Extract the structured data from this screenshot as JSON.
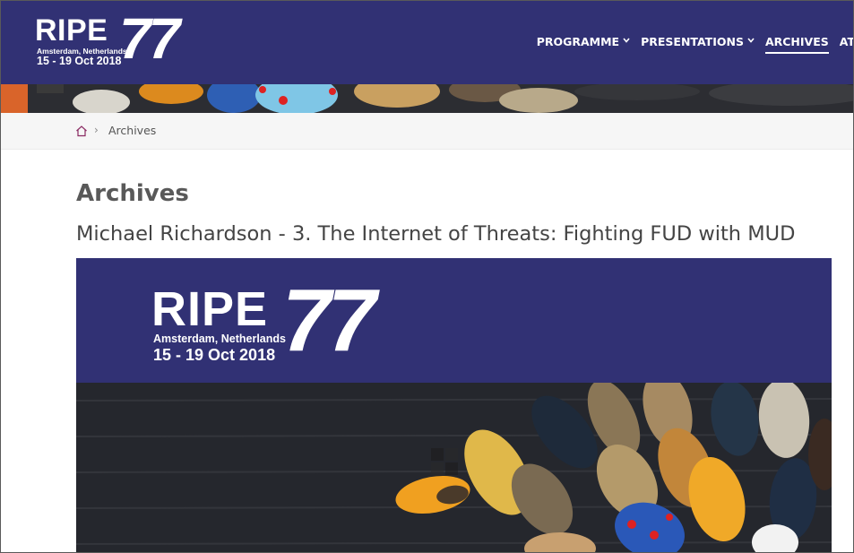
{
  "logo": {
    "ripe": "RIPE",
    "number": "77",
    "city": "Amsterdam, Netherlands",
    "dates": "15 - 19 Oct 2018"
  },
  "nav": {
    "items": [
      {
        "label": "PROGRAMME",
        "dropdown": true
      },
      {
        "label": "PRESENTATIONS",
        "dropdown": true
      },
      {
        "label": "ARCHIVES",
        "active": true
      },
      {
        "label": "AT",
        "cut": true
      }
    ]
  },
  "breadcrumb": {
    "home_icon": "home-icon",
    "current": "Archives"
  },
  "page": {
    "title": "Archives",
    "subtitle": "Michael Richardson - 3. The Internet of Threats: Fighting FUD with MUD"
  },
  "video": {
    "logo": {
      "ripe": "RIPE",
      "number": "77",
      "city": "Amsterdam, Netherlands",
      "dates": "15 - 19 Oct 2018"
    },
    "play_icon": "play-icon"
  },
  "colors": {
    "brand": "#313174",
    "breadcrumb_bg": "#f6f6f6",
    "home_icon": "#8a2a62"
  }
}
